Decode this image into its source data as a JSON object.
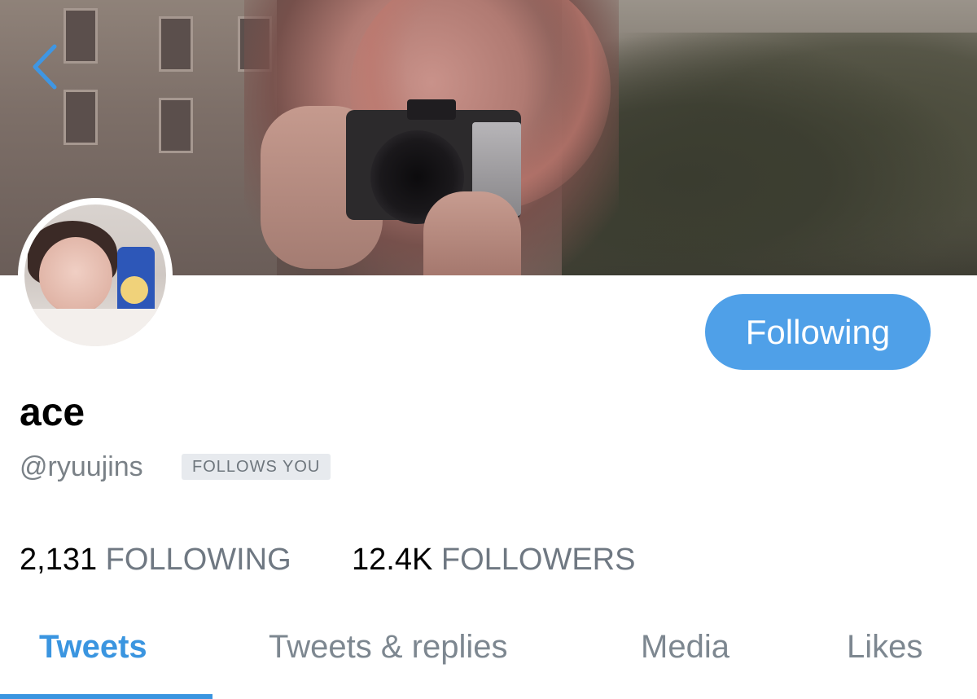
{
  "header": {
    "back_icon": "chevron-left-icon",
    "banner_image": "profile header photo"
  },
  "profile": {
    "avatar": "profile photo",
    "display_name": "ace",
    "handle": "@ryuujins",
    "follows_you_badge": "FOLLOWS YOU",
    "follow_button_label": "Following"
  },
  "stats": {
    "following_count": "2,131",
    "following_label": "FOLLOWING",
    "followers_count": "12.4K",
    "followers_label": "FOLLOWERS"
  },
  "tabs": [
    {
      "label": "Tweets",
      "active": true
    },
    {
      "label": "Tweets & replies",
      "active": false
    },
    {
      "label": "Media",
      "active": false
    },
    {
      "label": "Likes",
      "active": false
    }
  ],
  "colors": {
    "accent": "#3a95e0",
    "button": "#4fa0e8",
    "secondary_text": "#7a8187",
    "badge_bg": "#e7eaee"
  }
}
